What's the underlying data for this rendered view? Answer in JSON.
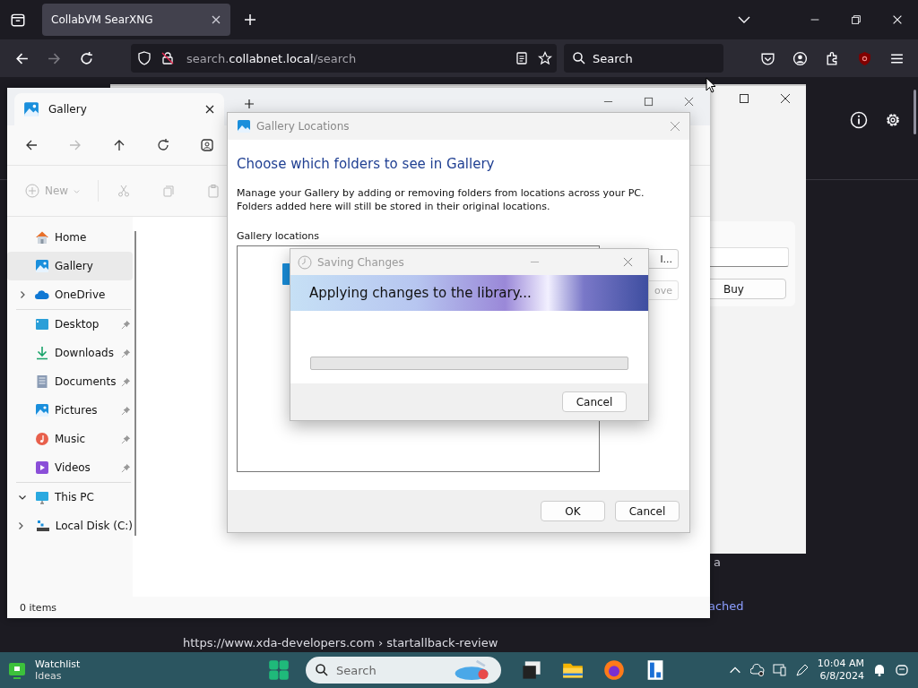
{
  "browser": {
    "tabs": [
      {
        "title": "CollabVM SearXNG",
        "selected": true
      }
    ],
    "url": "search.**collabnet.local**/search",
    "search": {
      "placeholder": "Search"
    }
  },
  "page": {
    "snippet_fragment": "a",
    "link_fragment": "ached",
    "result_url": "https://www.xda-developers.com › startallback-review"
  },
  "back_window": {
    "buy_button": "Buy"
  },
  "explorer": {
    "tab": "Gallery",
    "new_button": "New",
    "sidebar": [
      [
        {
          "label": "Home",
          "kind": "home",
          "selected": false
        },
        {
          "label": "Gallery",
          "kind": "gallery",
          "selected": true
        },
        {
          "label": "OneDrive",
          "kind": "cloud",
          "selected": false,
          "expanded": false
        }
      ],
      [
        {
          "label": "Desktop",
          "kind": "desktop",
          "selected": false,
          "pinned": true
        },
        {
          "label": "Downloads",
          "kind": "download",
          "selected": false,
          "pinned": true
        },
        {
          "label": "Documents",
          "kind": "document",
          "selected": false,
          "pinned": true
        },
        {
          "label": "Pictures",
          "kind": "gallery",
          "selected": false,
          "pinned": true
        },
        {
          "label": "Music",
          "kind": "music",
          "selected": false,
          "pinned": true
        },
        {
          "label": "Videos",
          "kind": "video",
          "selected": false,
          "pinned": true
        }
      ],
      [
        {
          "label": "This PC",
          "kind": "pc",
          "selected": false,
          "expanded": true,
          "children": [
            {
              "label": "Local Disk (C:)",
              "kind": "disk",
              "selected": false,
              "expanded": false
            }
          ]
        }
      ]
    ],
    "status": "0 items"
  },
  "locations_dialog": {
    "title": "Gallery Locations",
    "heading": "Choose which folders to see in Gallery",
    "description": "Manage your Gallery by adding or removing folders from locations across your PC. Folders added here will still be stored in their original locations.",
    "list_label": "Gallery locations",
    "side_buttons": [
      {
        "label": "l...",
        "disabled": false
      },
      {
        "label": "ove",
        "disabled": true
      }
    ],
    "buttons": [
      "OK",
      "Cancel"
    ]
  },
  "progress_dialog": {
    "title": "Saving Changes",
    "banner": "Applying changes to the library...",
    "progress": {
      "level": 0
    },
    "button": "Cancel"
  },
  "taskbar": {
    "widget": {
      "title": "Watchlist",
      "subtitle": "Ideas"
    },
    "search": {
      "placeholder": "Search"
    },
    "time": "10:04 AM",
    "date": "6/8/2024"
  }
}
